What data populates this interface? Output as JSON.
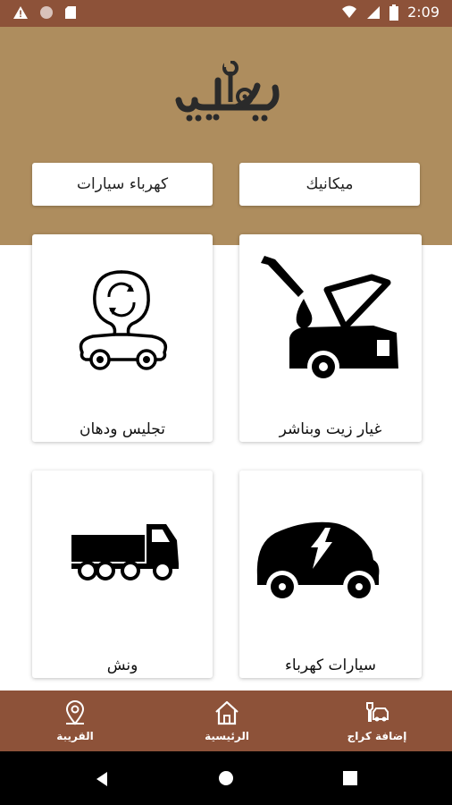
{
  "status_bar": {
    "time": "2:09"
  },
  "header": {
    "logo_text": "كراجي",
    "buttons": [
      {
        "label": "ميكانيك"
      },
      {
        "label": "كهرباء سيارات"
      }
    ]
  },
  "services": [
    {
      "label": "غيار زيت وبناشر",
      "icon": "oil-change-icon"
    },
    {
      "label": "تجليس ودهان",
      "icon": "car-paint-icon"
    },
    {
      "label": "سيارات كهرباء",
      "icon": "electric-car-icon"
    },
    {
      "label": "ونش",
      "icon": "tow-truck-icon"
    }
  ],
  "bottom_nav": [
    {
      "label": "إضافة كراج",
      "icon": "add-garage-icon"
    },
    {
      "label": "الرئيسية",
      "icon": "home-icon"
    },
    {
      "label": "القريبة",
      "icon": "location-pin-icon"
    }
  ],
  "colors": {
    "status_bar": "#8d5239",
    "header": "#ae8d5e",
    "nav": "#8d5239"
  }
}
